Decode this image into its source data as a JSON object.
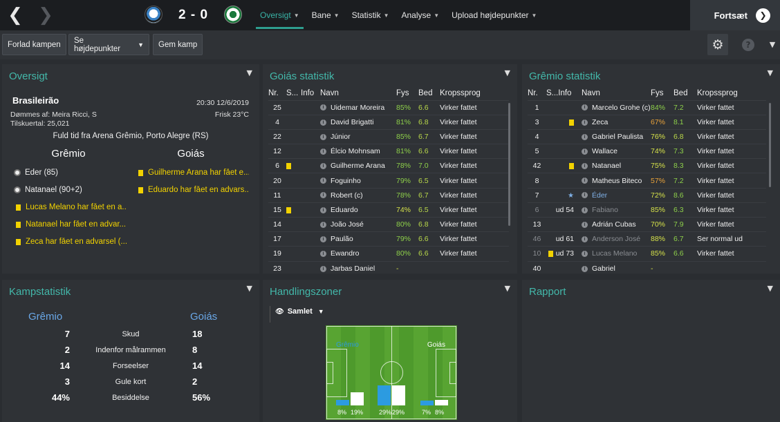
{
  "nav": {
    "back_icon": "chevron-left-icon",
    "forward_icon": "chevron-right-icon",
    "score": "2 - 0",
    "tabs": [
      {
        "label": "Oversigt",
        "active": true
      },
      {
        "label": "Bane",
        "active": false
      },
      {
        "label": "Statistik",
        "active": false
      },
      {
        "label": "Analyse",
        "active": false
      },
      {
        "label": "Upload højdepunkter",
        "active": false
      }
    ],
    "continue_label": "Fortsæt"
  },
  "actions": {
    "leave": "Forlad kampen",
    "highlights": "Se højdepunkter",
    "save": "Gem kamp"
  },
  "overview": {
    "title": "Oversigt",
    "competition": "Brasileirão",
    "datetime": "20:30 12/6/2019",
    "referee": "Dømmes af: Meira Ricci, S",
    "weather": "Frisk 23°C",
    "attendance": "Tilskuertal: 25,021",
    "venue": "Fuld tid fra Arena Grêmio, Porto Alegre (RS)",
    "home_team": "Grêmio",
    "away_team": "Goiás",
    "home_events": [
      {
        "type": "goal",
        "text": "Éder (85)"
      },
      {
        "type": "goal",
        "text": "Natanael (90+2)"
      },
      {
        "type": "card",
        "text": "Lucas Melano har fået en a..."
      },
      {
        "type": "card",
        "text": "Natanael har fået en advar..."
      },
      {
        "type": "card",
        "text": "Zeca har fået en advarsel (..."
      }
    ],
    "away_events": [
      {
        "type": "card",
        "text": "Guilherme Arana har fået e..."
      },
      {
        "type": "card",
        "text": "Eduardo har fået en advars..."
      }
    ]
  },
  "columns": {
    "nr": "Nr.",
    "s": "S...",
    "info": "Info",
    "name": "Navn",
    "fys": "Fys",
    "bed": "Bed",
    "body": "Kropssprog"
  },
  "goias_stats": {
    "title": "Goiás statistik",
    "players": [
      {
        "nr": "25",
        "sub": "",
        "card": false,
        "name": "Uidemar Moreira",
        "fys": "85%",
        "bed": "6.6",
        "body": "Virker fattet"
      },
      {
        "nr": "4",
        "sub": "",
        "card": false,
        "name": "David Brigatti",
        "fys": "81%",
        "bed": "6.8",
        "body": "Virker fattet"
      },
      {
        "nr": "22",
        "sub": "",
        "card": false,
        "name": "Júnior",
        "fys": "85%",
        "bed": "6.7",
        "body": "Virker fattet"
      },
      {
        "nr": "12",
        "sub": "",
        "card": false,
        "name": "Élcio Mohnsam",
        "fys": "81%",
        "bed": "6.6",
        "body": "Virker fattet"
      },
      {
        "nr": "6",
        "sub": "",
        "card": true,
        "name": "Guilherme Arana",
        "fys": "78%",
        "bed": "7.0",
        "body": "Virker fattet"
      },
      {
        "nr": "20",
        "sub": "",
        "card": false,
        "name": "Foguinho",
        "fys": "79%",
        "bed": "6.5",
        "body": "Virker fattet"
      },
      {
        "nr": "11",
        "sub": "",
        "card": false,
        "name": "Robert (c)",
        "fys": "78%",
        "bed": "6.7",
        "body": "Virker fattet"
      },
      {
        "nr": "15",
        "sub": "",
        "card": true,
        "name": "Eduardo",
        "fys": "74%",
        "bed": "6.5",
        "body": "Virker fattet"
      },
      {
        "nr": "14",
        "sub": "",
        "card": false,
        "name": "João José",
        "fys": "80%",
        "bed": "6.8",
        "body": "Virker fattet"
      },
      {
        "nr": "17",
        "sub": "",
        "card": false,
        "name": "Paulão",
        "fys": "79%",
        "bed": "6.6",
        "body": "Virker fattet"
      },
      {
        "nr": "19",
        "sub": "",
        "card": false,
        "name": "Ewandro",
        "fys": "80%",
        "bed": "6.6",
        "body": "Virker fattet"
      },
      {
        "nr": "23",
        "sub": "",
        "card": false,
        "name": "Jarbas Daniel",
        "fys": "-",
        "bed": "",
        "body": ""
      }
    ]
  },
  "gremio_stats": {
    "title": "Grêmio statistik",
    "players": [
      {
        "nr": "1",
        "sub": "",
        "mark": "",
        "name": "Marcelo Grohe (c)",
        "fys": "84%",
        "bed": "7.2",
        "body": "Virker fattet"
      },
      {
        "nr": "3",
        "sub": "",
        "mark": "card",
        "name": "Zeca",
        "fys": "67%",
        "bed": "8.1",
        "body": "Virker fattet"
      },
      {
        "nr": "4",
        "sub": "",
        "mark": "",
        "name": "Gabriel Paulista",
        "fys": "76%",
        "bed": "6.8",
        "body": "Virker fattet"
      },
      {
        "nr": "5",
        "sub": "",
        "mark": "",
        "name": "Wallace",
        "fys": "74%",
        "bed": "7.3",
        "body": "Virker fattet"
      },
      {
        "nr": "42",
        "sub": "",
        "mark": "card",
        "name": "Natanael",
        "fys": "75%",
        "bed": "8.3",
        "body": "Virker fattet"
      },
      {
        "nr": "8",
        "sub": "",
        "mark": "",
        "name": "Matheus Biteco",
        "fys": "57%",
        "bed": "7.2",
        "body": "Virker fattet"
      },
      {
        "nr": "7",
        "sub": "",
        "mark": "star",
        "name": "Éder",
        "fys": "72%",
        "bed": "8.6",
        "body": "Virker fattet"
      },
      {
        "nr": "6",
        "sub": "ud 54",
        "mark": "",
        "name": "Fabiano",
        "fys": "85%",
        "bed": "6.3",
        "body": "Virker fattet"
      },
      {
        "nr": "13",
        "sub": "",
        "mark": "",
        "name": "Adrián Cubas",
        "fys": "70%",
        "bed": "7.9",
        "body": "Virker fattet"
      },
      {
        "nr": "46",
        "sub": "ud 61",
        "mark": "",
        "name": "Anderson José",
        "fys": "88%",
        "bed": "6.7",
        "body": "Ser normal ud"
      },
      {
        "nr": "10",
        "sub": "ud 73",
        "mark": "card",
        "name": "Lucas Melano",
        "fys": "85%",
        "bed": "6.6",
        "body": "Virker fattet"
      },
      {
        "nr": "40",
        "sub": "",
        "mark": "",
        "name": "Gabriel",
        "fys": "-",
        "bed": "",
        "body": ""
      }
    ]
  },
  "match_stats": {
    "title": "Kampstatistik",
    "home": "Grêmio",
    "away": "Goiás",
    "rows": [
      {
        "label": "Skud",
        "home": "7",
        "away": "18"
      },
      {
        "label": "Indenfor målrammen",
        "home": "2",
        "away": "8"
      },
      {
        "label": "Forseelser",
        "home": "14",
        "away": "14"
      },
      {
        "label": "Gule kort",
        "home": "3",
        "away": "2"
      },
      {
        "label": "Besiddelse",
        "home": "44%",
        "away": "56%"
      }
    ]
  },
  "zones": {
    "title": "Handlingszoner",
    "view": "Samlet",
    "home_label": "Grêmio",
    "away_label": "Goiás",
    "zone_list": [
      {
        "home": 8,
        "away": 19,
        "home_label": "8%",
        "away_label": "19%"
      },
      {
        "home": 29,
        "away": 29,
        "home_label": "29%",
        "away_label": "29%"
      },
      {
        "home": 7,
        "away": 8,
        "home_label": "7%",
        "away_label": "8%"
      }
    ],
    "colors": {
      "home": "#2c9be0",
      "away": "#ffffff"
    }
  },
  "report": {
    "title": "Rapport"
  }
}
